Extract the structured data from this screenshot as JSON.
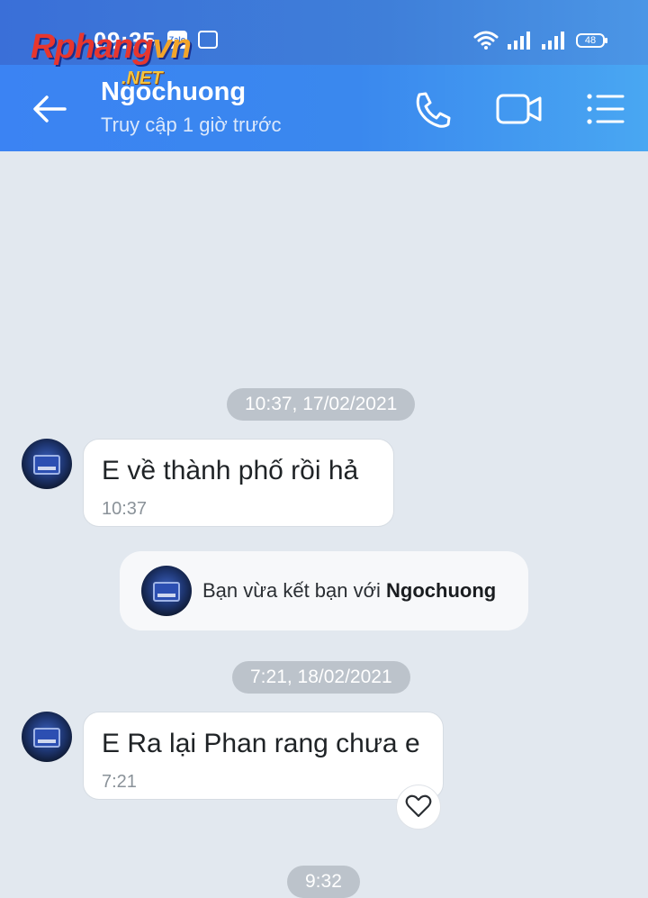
{
  "status_bar": {
    "time": "09:35",
    "app_icon_1": "Zalo",
    "battery": "48",
    "icons": [
      "wifi-icon",
      "signal-icon",
      "signal-icon",
      "battery-icon"
    ]
  },
  "watermark": {
    "part1": "Rphang",
    "part2": "vn",
    "suffix": ".NET"
  },
  "header": {
    "name": "Ngochuong",
    "last_seen": "Truy cập 1 giờ trước",
    "icons": [
      "back-arrow-icon",
      "phone-icon",
      "video-call-icon",
      "menu-list-icon"
    ]
  },
  "chat": {
    "date_1": "10:37, 17/02/2021",
    "msg_1": {
      "text": "E về thành phố rồi hả",
      "time": "10:37"
    },
    "friend_notice": {
      "prefix": "Bạn vừa kết bạn với ",
      "name": "Ngochuong"
    },
    "date_2": "7:21, 18/02/2021",
    "msg_2": {
      "text": "E Ra lại Phan rang chưa e",
      "time": "7:21"
    },
    "date_3": "9:32"
  },
  "colors": {
    "header": "#3a88ee",
    "chat_background": "#e2e8ef",
    "date_pill": "#bcc3cb"
  }
}
